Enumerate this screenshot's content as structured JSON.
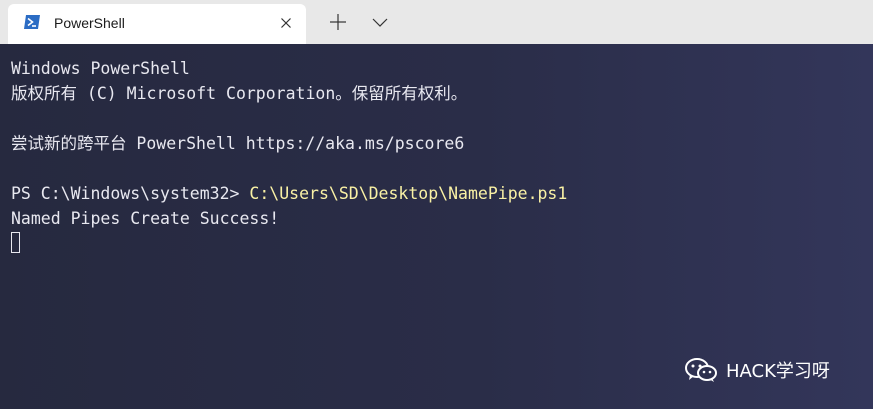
{
  "tab": {
    "title": "PowerShell",
    "icon": "powershell-icon"
  },
  "titlebar": {
    "new_tab_icon": "plus-icon",
    "dropdown_icon": "chevron-down-icon",
    "close_icon": "close-icon"
  },
  "terminal": {
    "line1": "Windows PowerShell",
    "line2": "版权所有 (C) Microsoft Corporation。保留所有权利。",
    "line3": "尝试新的跨平台 PowerShell https://aka.ms/pscore6",
    "prompt": "PS C:\\Windows\\system32> ",
    "command": "C:\\Users\\SD\\Desktop\\NamePipe.ps1",
    "output": "Named Pipes Create Success!"
  },
  "watermark": {
    "text": "HACK学习呀",
    "icon": "wechat-icon"
  },
  "colors": {
    "terminal_bg": "#2b2e4a",
    "terminal_fg": "#e8e8f0",
    "command_fg": "#f9f1a5",
    "titlebar_bg": "#e8e8e8"
  }
}
